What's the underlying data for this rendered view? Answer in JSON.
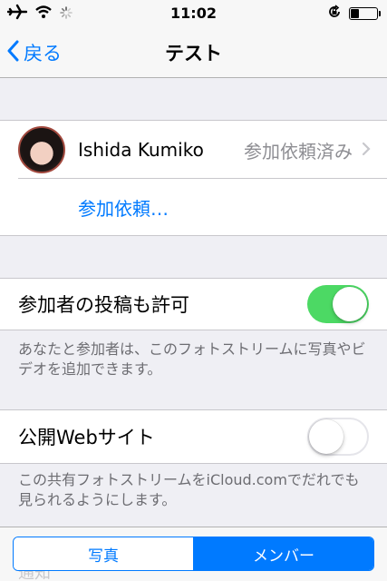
{
  "status_bar": {
    "time": "11:02",
    "icons": [
      "airplane-icon",
      "wifi-icon",
      "activity-spinner-icon",
      "rotation-lock-icon",
      "battery-icon"
    ],
    "battery_level": 0.3
  },
  "nav": {
    "back_label": "戻る",
    "title": "テスト"
  },
  "members": {
    "name": "Ishida Kumiko",
    "status": "参加依頼済み",
    "invite_link": "参加依頼…"
  },
  "settings": {
    "allow_posts_label": "参加者の投稿も許可",
    "allow_posts_on": true,
    "allow_posts_note": "あなたと参加者は、このフォトストリームに写真やビデオを追加できます。",
    "public_site_label": "公開Webサイト",
    "public_site_on": false,
    "public_site_note": "この共有フォトストリームをiCloud.comでだれでも見られるようにします。"
  },
  "toolbar": {
    "ghost_label": "通知",
    "segments": [
      "写真",
      "メンバー"
    ],
    "active_index": 1
  },
  "colors": {
    "tint": "#007aff",
    "switch_on": "#4cd964",
    "background": "#efeff4"
  }
}
